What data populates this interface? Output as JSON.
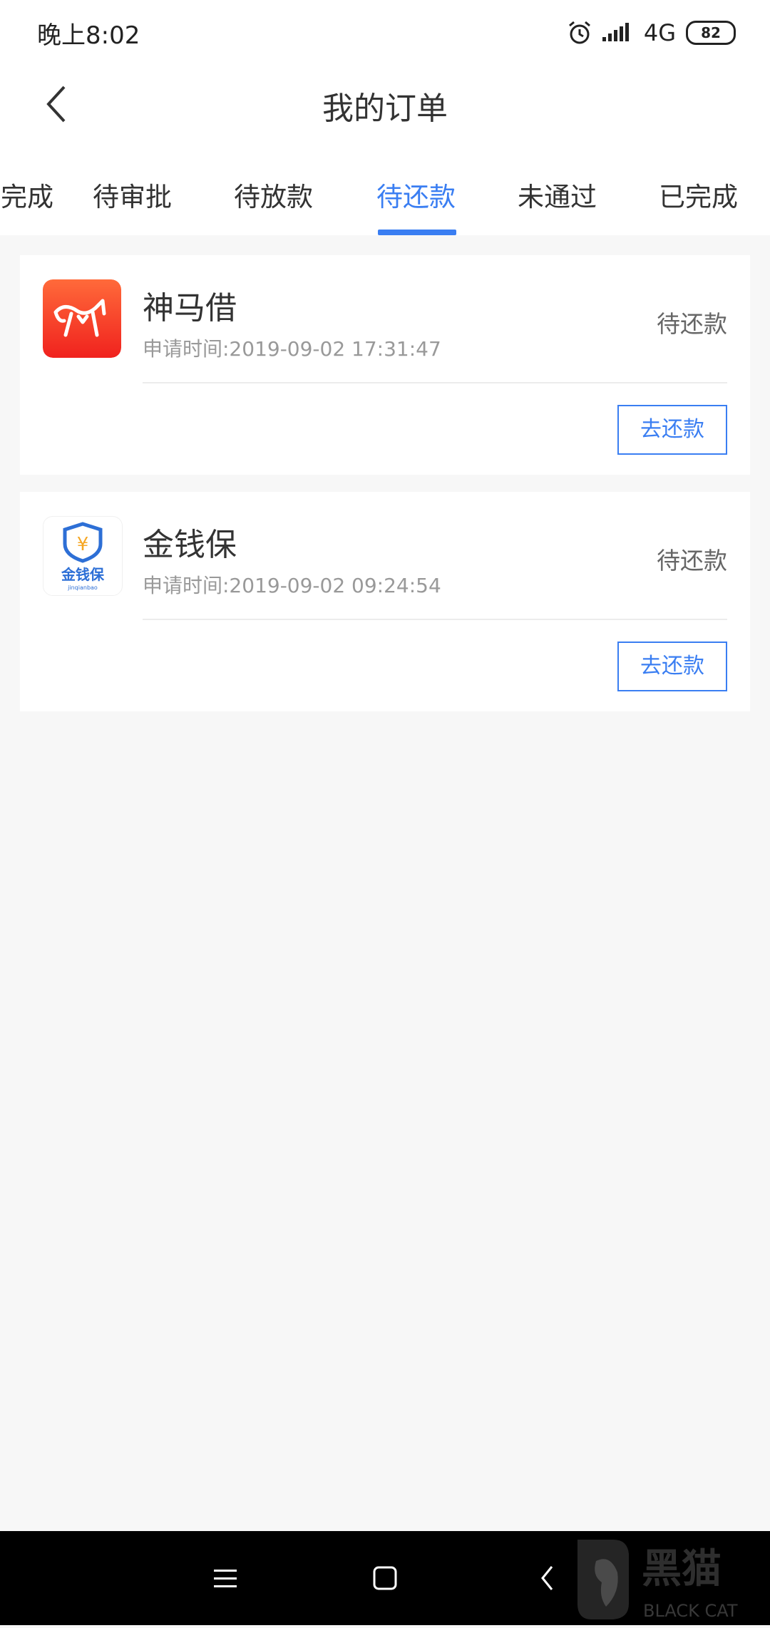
{
  "status_bar": {
    "time": "晚上8:02",
    "network": "4G",
    "battery": "82"
  },
  "header": {
    "title": "我的订单"
  },
  "tabs": [
    {
      "label": "已完成",
      "active": false
    },
    {
      "label": "待审批",
      "active": false
    },
    {
      "label": "待放款",
      "active": false
    },
    {
      "label": "待还款",
      "active": true
    },
    {
      "label": "未通过",
      "active": false
    },
    {
      "label": "已完成",
      "active": false
    }
  ],
  "orders": [
    {
      "name": "神马借",
      "apply_time": "申请时间:2019-09-02 17:31:47",
      "status": "待还款",
      "action": "去还款",
      "logo_color": "#f23a2a"
    },
    {
      "name": "金钱保",
      "apply_time": "申请时间:2019-09-02 09:24:54",
      "status": "待还款",
      "action": "去还款",
      "logo_text": "金钱保",
      "logo_sub": "jinqianbao",
      "logo_symbol": "¥",
      "logo_color": "#2d6fd6"
    }
  ],
  "nav_bar": {
    "icons": [
      "menu-icon",
      "home-icon",
      "back-icon"
    ]
  },
  "watermark": {
    "text": "黑猫",
    "sub": "BLACK CAT"
  }
}
